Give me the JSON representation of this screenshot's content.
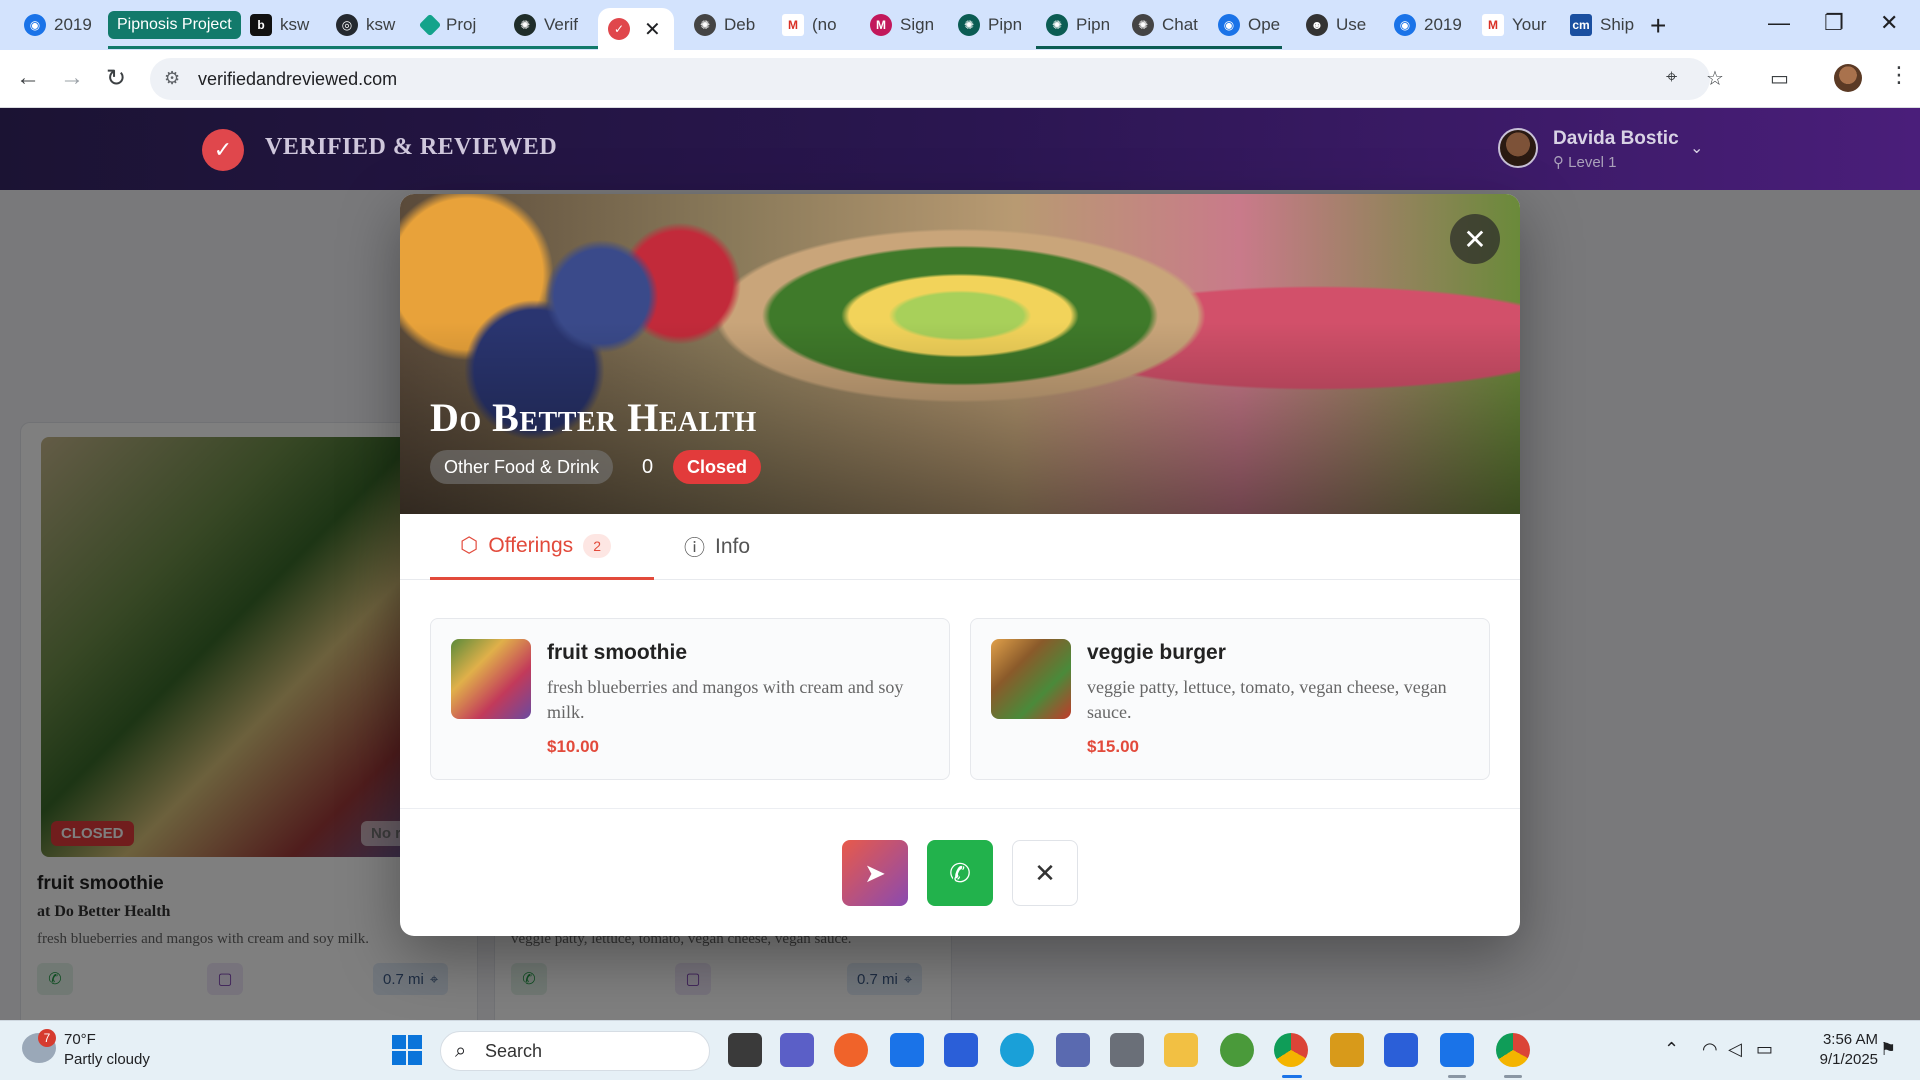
{
  "browser": {
    "tabs": [
      {
        "label": "2019",
        "favicon": "circle-blue-icon",
        "color": "#1a73e8"
      },
      {
        "label": "ksw",
        "favicon": "b-icon",
        "color": "#111111"
      },
      {
        "label": "ksw",
        "favicon": "github-icon",
        "color": "#24292f"
      },
      {
        "label": "Proj",
        "favicon": "diamond-icon",
        "color": "#14a38b"
      },
      {
        "label": "Verif",
        "favicon": "openai-icon",
        "color": "#1f2d2a"
      },
      {
        "label": "",
        "favicon": "check-badge-icon",
        "color": "#e0474c"
      },
      {
        "label": "Deb",
        "favicon": "openai-icon",
        "color": "#444444"
      },
      {
        "label": "(no",
        "favicon": "gmail-icon",
        "color": "#d93025"
      },
      {
        "label": "Sign",
        "favicon": "m-icon",
        "color": "#c2185b"
      },
      {
        "label": "Pipn",
        "favicon": "openai-icon",
        "color": "#0b5c53"
      },
      {
        "label": "Pipn",
        "favicon": "openai-icon",
        "color": "#0b5c53"
      },
      {
        "label": "Chat",
        "favicon": "openai-icon",
        "color": "#444444"
      },
      {
        "label": "Ope",
        "favicon": "circle-blue-icon",
        "color": "#1a73e8"
      },
      {
        "label": "Use",
        "favicon": "robot-icon",
        "color": "#333333"
      },
      {
        "label": "2019",
        "favicon": "circle-blue-icon",
        "color": "#1a73e8"
      },
      {
        "label": "Your",
        "favicon": "gmail-icon",
        "color": "#d93025"
      },
      {
        "label": "Ship",
        "favicon": "cm-icon",
        "color": "#1a4fa0"
      }
    ],
    "tab_group_label": "Pipnosis Project",
    "url": "verifiedandreviewed.com"
  },
  "site": {
    "title": "VERIFIED & REVIEWED",
    "user_name": "Davida Bostic",
    "user_level": "Level 1"
  },
  "background_cards": [
    {
      "title": "fruit smoothie",
      "subtitle": "at Do Better Health",
      "description": "fresh blueberries and mangos with cream and soy milk.",
      "status": "CLOSED",
      "rating": "No ra",
      "distance": "0.7 mi"
    },
    {
      "title": "",
      "subtitle": "",
      "description": "veggie patty, lettuce, tomato, vegan cheese, vegan sauce.",
      "status": "",
      "rating": "",
      "distance": "0.7 mi"
    }
  ],
  "modal": {
    "business_name": "Do Better Health",
    "category": "Other Food & Drink",
    "review_count": "0",
    "status": "Closed",
    "tabs": [
      {
        "label": "Offerings",
        "count": "2"
      },
      {
        "label": "Info"
      }
    ],
    "offerings": [
      {
        "name": "fruit smoothie",
        "description": "fresh blueberries and mangos with cream and soy milk.",
        "price": "$10.00"
      },
      {
        "name": "veggie burger",
        "description": "veggie patty, lettuce, tomato, vegan cheese, vegan sauce.",
        "price": "$15.00"
      }
    ],
    "colors": {
      "accent": "#e24a3b",
      "call": "#22b24c",
      "closed": "#e23b3b"
    }
  },
  "taskbar": {
    "weather_temp": "70°F",
    "weather_desc": "Partly cloudy",
    "weather_alert_count": "7",
    "search_label": "Search",
    "time": "3:56 AM",
    "date": "9/1/2025"
  }
}
